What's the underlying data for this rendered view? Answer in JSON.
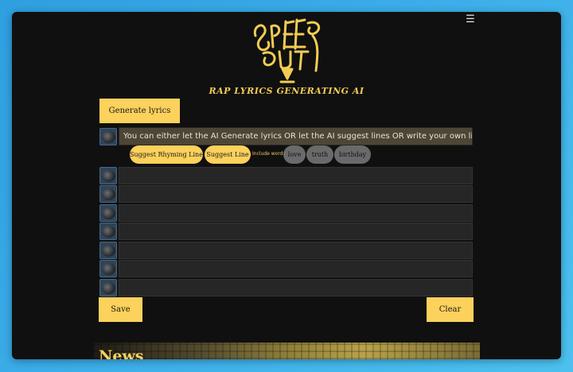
{
  "header": {
    "menu_icon": "menu-icon",
    "tagline": "RAP LYRICS GENERATING AI"
  },
  "toolbar": {
    "generate_label": "Generate lyrics"
  },
  "intro": {
    "text": "You can either let the AI Generate lyrics OR let the AI suggest lines OR write your own lines."
  },
  "suggest": {
    "rhyming_label": "Suggest Rhyming Line",
    "line_label": "Suggest Line",
    "include_label": "Include word:",
    "words": [
      "love",
      "truth",
      "birthday"
    ]
  },
  "lyrics": {
    "lines": [
      "",
      "",
      "",
      "",
      "",
      "",
      ""
    ]
  },
  "actions": {
    "save_label": "Save",
    "clear_label": "Clear"
  },
  "news": {
    "title": "News"
  },
  "colors": {
    "accent": "#fcd15c",
    "background": "#101010",
    "pill_gray": "#6a6a6a"
  }
}
